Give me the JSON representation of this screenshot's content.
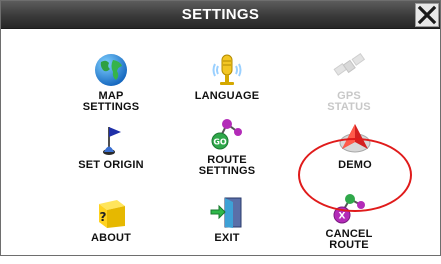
{
  "window": {
    "title": "SETTINGS",
    "close_symbol": "✕"
  },
  "tiles": [
    {
      "id": "map-settings",
      "label": "MAP\nSETTINGS",
      "icon": "globe-icon",
      "enabled": true
    },
    {
      "id": "language",
      "label": "LANGUAGE",
      "icon": "microphone-icon",
      "enabled": true
    },
    {
      "id": "gps-status",
      "label": "GPS\nSTATUS",
      "icon": "satellite-icon",
      "enabled": false
    },
    {
      "id": "set-origin",
      "label": "SET ORIGIN",
      "icon": "flag-icon",
      "enabled": true
    },
    {
      "id": "route-settings",
      "label": "ROUTE\nSETTINGS",
      "icon": "route-nodes-icon",
      "icon_text": "GO",
      "enabled": true
    },
    {
      "id": "demo",
      "label": "DEMO",
      "icon": "demo-arrow-icon",
      "enabled": true
    },
    {
      "id": "about",
      "label": "ABOUT",
      "icon": "question-block-icon",
      "icon_text": "?",
      "enabled": true
    },
    {
      "id": "exit",
      "label": "EXIT",
      "icon": "exit-door-icon",
      "enabled": true
    },
    {
      "id": "cancel-route",
      "label": "CANCEL\nROUTE",
      "icon": "cancel-route-icon",
      "icon_text": "X",
      "enabled": true
    }
  ],
  "annotation": {
    "highlighted_tile": "demo",
    "color": "#e01b1b"
  },
  "colors": {
    "titlebar": "#3a3a3a",
    "title_text": "#ffffff",
    "disabled_text": "#c8c8c8"
  }
}
